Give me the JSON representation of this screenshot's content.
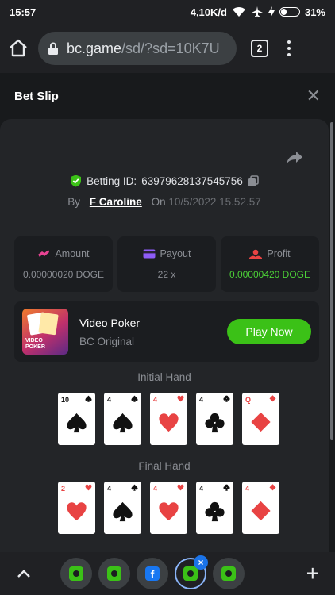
{
  "status_bar": {
    "time": "15:57",
    "data_rate": "4,10K/d",
    "battery": "31%",
    "battery_level": 0.31
  },
  "browser": {
    "url_domain": "bc.game",
    "url_path": "/sd/?sd=10K7U",
    "tab_count": "2"
  },
  "bet_slip": {
    "title": "Bet Slip",
    "betting_id_label": "Betting ID:",
    "betting_id": "63979628137545756",
    "by_label": "By",
    "username": "F Caroline",
    "on_label": "On",
    "datetime": "10/5/2022 15.52.57"
  },
  "stats": {
    "amount_label": "Amount",
    "amount_value": "0.00000020 DOGE",
    "payout_label": "Payout",
    "payout_value": "22 x",
    "profit_label": "Profit",
    "profit_value": "0.00000420 DOGE"
  },
  "game": {
    "name": "Video Poker",
    "subtitle": "BC Original",
    "thumb_text_1": "VIDEO",
    "thumb_text_2": "POKER",
    "play_label": "Play Now"
  },
  "initial_hand": {
    "label": "Initial Hand",
    "cards": [
      {
        "rank": "10",
        "suit": "spade"
      },
      {
        "rank": "4",
        "suit": "spade"
      },
      {
        "rank": "4",
        "suit": "heart"
      },
      {
        "rank": "4",
        "suit": "club"
      },
      {
        "rank": "Q",
        "suit": "diamond"
      }
    ]
  },
  "final_hand": {
    "label": "Final Hand",
    "cards": [
      {
        "rank": "2",
        "suit": "heart"
      },
      {
        "rank": "4",
        "suit": "spade"
      },
      {
        "rank": "4",
        "suit": "heart"
      },
      {
        "rank": "4",
        "suit": "club"
      },
      {
        "rank": "4",
        "suit": "diamond"
      }
    ]
  },
  "colors": {
    "accent_green": "#3bc117",
    "profit_green": "#4cd137",
    "background": "#232528"
  },
  "bottom_bar": {
    "tab_icons": [
      "bc-game-icon",
      "bc-game-icon",
      "facebook-icon",
      "bc-game-icon",
      "bc-game-icon"
    ],
    "close_badge": "×",
    "add_label": "+"
  }
}
